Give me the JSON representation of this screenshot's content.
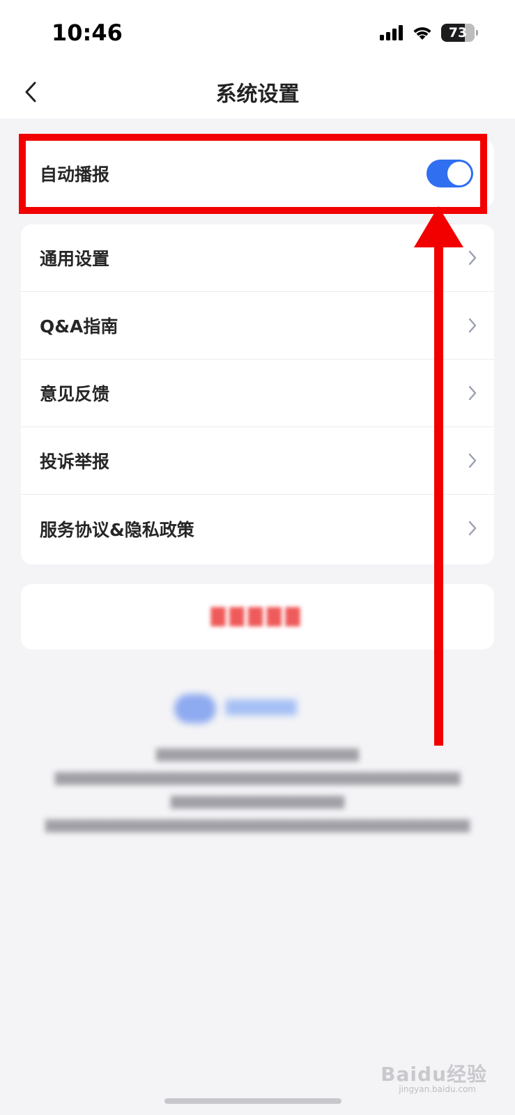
{
  "status_bar": {
    "time": "10:46",
    "battery": "73"
  },
  "nav": {
    "title": "系统设置"
  },
  "toggle_row": {
    "label": "自动播报",
    "enabled": true,
    "accent_color": "#2f6ff0"
  },
  "menu": {
    "items": [
      {
        "label": "通用设置"
      },
      {
        "label": "Q&A指南"
      },
      {
        "label": "意见反馈"
      },
      {
        "label": "投诉举报"
      },
      {
        "label": "服务协议&隐私政策"
      }
    ]
  },
  "annotation_color": "#f20000",
  "watermark": {
    "text": "Baidu经验",
    "sub": "jingyan.baidu.com"
  }
}
